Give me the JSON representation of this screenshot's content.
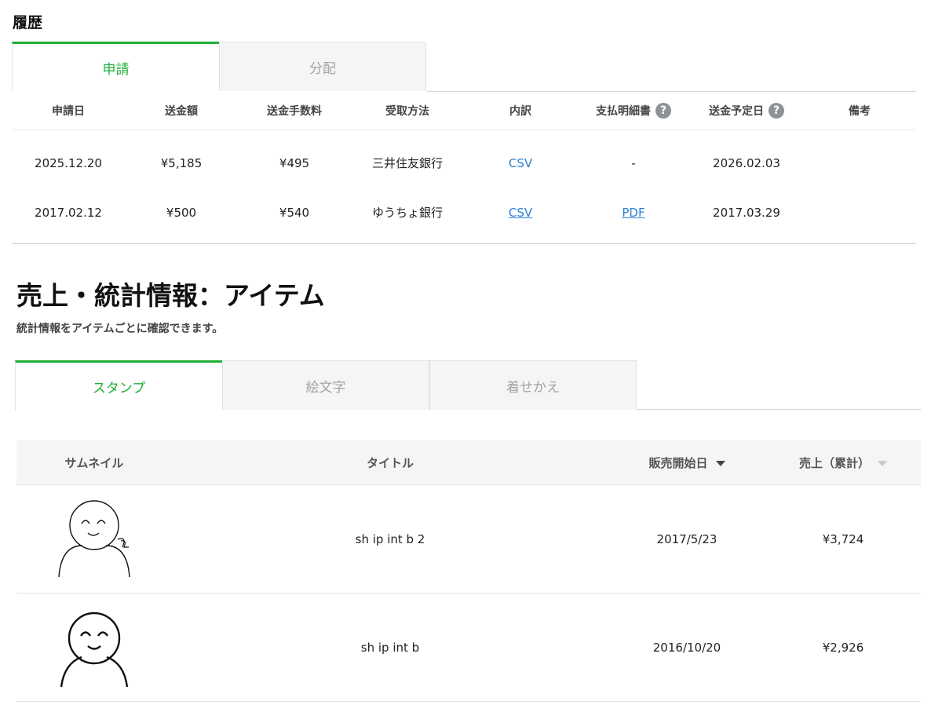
{
  "history": {
    "title": "履歴",
    "tabs": [
      {
        "label": "申請",
        "active": true
      },
      {
        "label": "分配",
        "active": false
      }
    ],
    "columns": [
      "申請日",
      "送金額",
      "送金手数料",
      "受取方法",
      "内訳",
      "支払明細書",
      "送金予定日",
      "備考"
    ],
    "rows": [
      {
        "date": "2025.12.20",
        "amount": "¥5,185",
        "fee": "¥495",
        "method": "三井住友銀行",
        "detail": "CSV",
        "statement": "-",
        "scheduled": "2026.02.03",
        "note": ""
      },
      {
        "date": "2017.02.12",
        "amount": "¥500",
        "fee": "¥540",
        "method": "ゆうちょ銀行",
        "detail": "CSV",
        "statement": "PDF",
        "scheduled": "2017.03.29",
        "note": ""
      }
    ]
  },
  "sales": {
    "title": "売上・統計情報：アイテム",
    "description": "統計情報をアイテムごとに確認できます。",
    "tabs": [
      {
        "label": "スタンプ",
        "active": true
      },
      {
        "label": "絵文字",
        "active": false
      },
      {
        "label": "着せかえ",
        "active": false
      }
    ],
    "columns": {
      "thumbnail": "サムネイル",
      "title": "タイトル",
      "release_date": "販売開始日",
      "sales_total": "売上（累計）"
    },
    "items": [
      {
        "title": "sh ip int b 2",
        "release_date": "2017/5/23",
        "sales": "¥3,724"
      },
      {
        "title": "sh ip int b",
        "release_date": "2016/10/20",
        "sales": "¥2,926"
      }
    ]
  },
  "colors": {
    "accent": "#1fae38",
    "link": "#2b80d6"
  }
}
